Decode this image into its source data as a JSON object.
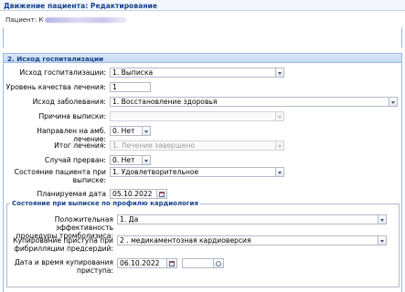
{
  "window": {
    "title": "Движение пациента: Редактирование"
  },
  "patient": {
    "label": "Пациент:",
    "value": "К"
  },
  "section2": {
    "title": "2. Исход госпитализации"
  },
  "fields": {
    "outcome": {
      "label": "Исход госпитализации:",
      "value": "1. Выписка"
    },
    "treatment_quality": {
      "label": "Уровень качества лечения:",
      "value": "1"
    },
    "disease_outcome": {
      "label": "Исход заболевания:",
      "value": "1. Восстановление здоровья"
    },
    "discharge_reason": {
      "label": "Причина выписки:",
      "value": ""
    },
    "outpatient_referral": {
      "label": "Направлен на амб. лечение:",
      "value": "0. Нет"
    },
    "treatment_result": {
      "label": "Итог лечения:",
      "value": "1. Лечение завершено"
    },
    "case_interrupted": {
      "label": "Случай прерван:",
      "value": "0. Нет"
    },
    "discharge_state": {
      "label_line1": "Состояние пациента при",
      "label_line2": "выписке:",
      "value": "1. Удовлетворительное"
    },
    "planned_discharge": {
      "label": "Планируемая дата выписки:",
      "value": "05.10.2022"
    }
  },
  "cardio": {
    "legend": "Состояние при выписке по профилю кардиология",
    "thrombolysis": {
      "label_line1": "Положительная эффективность",
      "label_line2": "процедуры тромболизиса:",
      "value": "1. Да"
    },
    "af_relief": {
      "label_line1": "Купирование приступа при",
      "label_line2": "фибрилляции предсердий:",
      "value": "2 . медикаментозная кардиоверсия"
    },
    "relief_datetime": {
      "label_line1": "Дата и время купирования",
      "label_line2": "приступа:",
      "date": "06.10.2022",
      "time": ""
    }
  },
  "icons": {
    "dropdown": "chevron-down-icon",
    "calendar": "calendar-icon",
    "clock": "clock-icon"
  }
}
